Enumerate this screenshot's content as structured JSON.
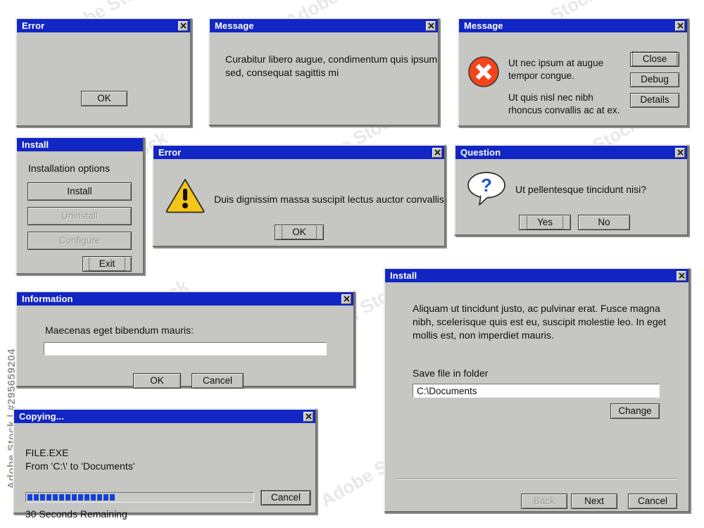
{
  "meta": {
    "watermark_text": "Adobe Stock",
    "sidebar_credit": "Adobe Stock | #295659204"
  },
  "icons": {
    "close": "close-x-icon",
    "error": "error-circle-icon",
    "warning": "warning-triangle-icon",
    "question": "question-bubble-icon"
  },
  "colors": {
    "titlebar": "#1226c4",
    "face": "#c6c6c3",
    "error_red": "#f4441c",
    "warning_yellow": "#f5c518",
    "question_blue": "#1f54c8",
    "progress_blue": "#1540d8"
  },
  "dialogs": {
    "error_plain": {
      "title": "Error",
      "ok_label": "OK"
    },
    "message_text": {
      "title": "Message",
      "line1": "Curabitur libero augue, condimentum quis ipsum",
      "line2": "sed, consequat sagittis mi"
    },
    "message_error": {
      "title": "Message",
      "para1_line1": "Ut nec ipsum at augue",
      "para1_line2": "tempor congue.",
      "para2_line1": "Ut quis nisl nec nibh",
      "para2_line2": "rhoncus convallis ac at ex.",
      "close_label": "Close",
      "debug_label": "Debug",
      "details_label": "Details"
    },
    "install_options": {
      "title": "Install",
      "heading": "Installation options",
      "install_label": "Install",
      "uninstall_label": "Uninstall",
      "configure_label": "Configure",
      "exit_label": "Exit"
    },
    "error_warning": {
      "title": "Error",
      "message": "Duis dignissim massa suscipit lectus auctor convallis",
      "ok_label": "OK"
    },
    "question": {
      "title": "Question",
      "message": "Ut pellentesque tincidunt nisi?",
      "yes_label": "Yes",
      "no_label": "No"
    },
    "information": {
      "title": "Information",
      "label": "Maecenas eget bibendum mauris:",
      "input_value": "",
      "ok_label": "OK",
      "cancel_label": "Cancel"
    },
    "copying": {
      "title": "Copying...",
      "file_name": "FILE.EXE",
      "path_line": "From 'C:\\' to 'Documents'",
      "progress_blocks": 14,
      "status": "30 Seconds Remaining",
      "cancel_label": "Cancel"
    },
    "install_wizard": {
      "title": "Install",
      "body_line1": "Aliquam ut tincidunt justo, ac pulvinar erat. Fusce magna",
      "body_line2": "nibh, scelerisque quis est eu, suscipit molestie leo. In eget",
      "body_line3": "mollis est, non imperdiet mauris.",
      "folder_label": "Save file in folder",
      "folder_value": "C:\\Documents",
      "change_label": "Change",
      "back_label": "Back",
      "next_label": "Next",
      "cancel_label": "Cancel"
    }
  }
}
